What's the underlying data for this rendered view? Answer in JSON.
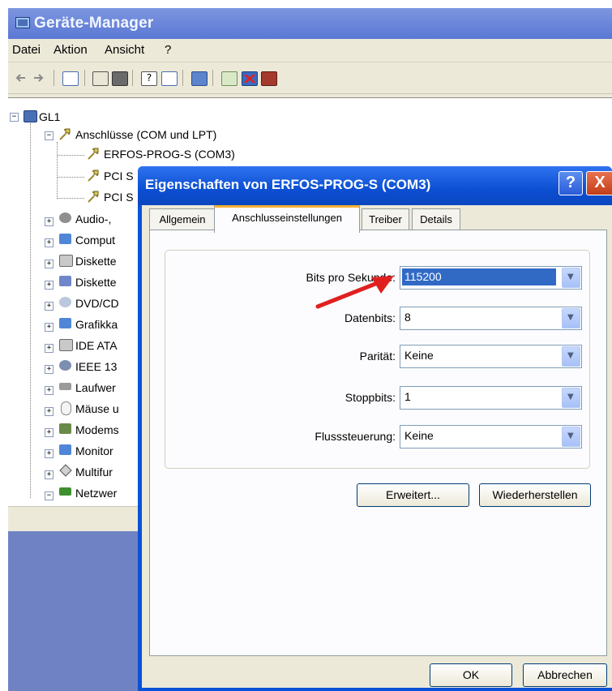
{
  "device_manager": {
    "title": "Geräte-Manager",
    "menu": [
      "Datei",
      "Aktion",
      "Ansicht",
      "?"
    ],
    "toolbar_icons": [
      "back-icon",
      "forward-icon",
      "console-tree-icon",
      "properties-icon",
      "print-icon",
      "help-icon",
      "view-icon",
      "scan-icon",
      "update-driver-icon",
      "disable-icon",
      "uninstall-icon"
    ],
    "tree": {
      "root": "GL1",
      "ports_group": "Anschlüsse (COM und LPT)",
      "ports_children": [
        "ERFOS-PROG-S (COM3)",
        "PCI S",
        "PCI S"
      ],
      "categories": [
        {
          "label": "Audio-,",
          "icon": "audio-icon"
        },
        {
          "label": "Comput",
          "icon": "computer-icon"
        },
        {
          "label": "Diskette",
          "icon": "floppy-controller-icon"
        },
        {
          "label": "Diskette",
          "icon": "floppy-drive-icon"
        },
        {
          "label": "DVD/CD",
          "icon": "dvd-icon"
        },
        {
          "label": "Grafikka",
          "icon": "display-adapter-icon"
        },
        {
          "label": "IDE ATA",
          "icon": "ide-icon"
        },
        {
          "label": "IEEE 13",
          "icon": "ieee1394-icon"
        },
        {
          "label": "Laufwer",
          "icon": "disk-drive-icon"
        },
        {
          "label": "Mäuse u",
          "icon": "mouse-icon"
        },
        {
          "label": "Modems",
          "icon": "modem-icon"
        },
        {
          "label": "Monitor",
          "icon": "monitor-icon"
        },
        {
          "label": "Multifur",
          "icon": "multifunction-icon"
        },
        {
          "label": "Netzwer",
          "icon": "network-icon"
        }
      ]
    }
  },
  "dialog": {
    "title": "Eigenschaften von ERFOS-PROG-S (COM3)",
    "help_label": "?",
    "close_label": "X",
    "tabs": [
      "Allgemein",
      "Anschlusseinstellungen",
      "Treiber",
      "Details"
    ],
    "active_tab": "Anschlusseinstellungen",
    "settings": [
      {
        "label": "Bits pro Sekunde:",
        "value": "115200"
      },
      {
        "label": "Datenbits:",
        "value": "8"
      },
      {
        "label": "Parität:",
        "value": "Keine"
      },
      {
        "label": "Stoppbits:",
        "value": "1"
      },
      {
        "label": "Flusssteuerung:",
        "value": "Keine"
      }
    ],
    "buttons": {
      "advanced": "Erweitert...",
      "restore": "Wiederherstellen",
      "ok": "OK",
      "cancel": "Abbrechen"
    },
    "annotation_arrow_color": "#e02020"
  }
}
